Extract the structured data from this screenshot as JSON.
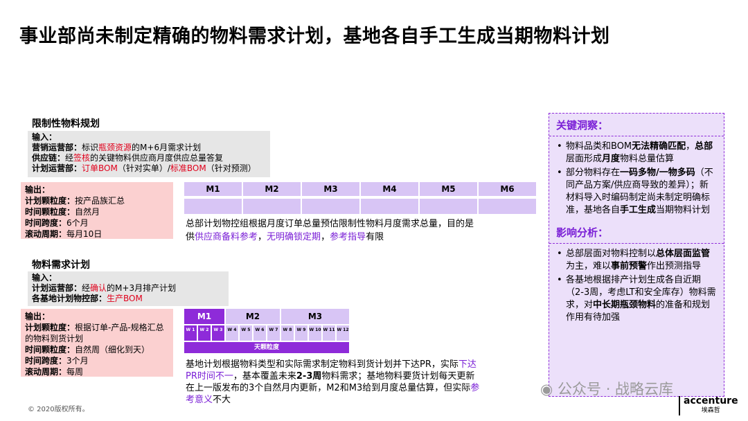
{
  "title": "事业部尚未制定精确的物料需求计划，基地各自手工生成当期物料计划",
  "section1": {
    "heading": "限制性物料规划",
    "input_label": "输入：",
    "inputs": [
      {
        "label": "营销运营部：",
        "pre": "标识",
        "hl": "瓶颈资源",
        "post": "的M+6月需求计划"
      },
      {
        "label": "供应链：",
        "pre": "经",
        "hl": "签核",
        "post": "的关键物料供应商月度供应总量答复"
      },
      {
        "label": "计划运营部：",
        "pre": "",
        "hl": "订单BOM",
        "mid": "（针对实单）/",
        "hl2": "标准BOM",
        "post": "（针对预测）"
      }
    ],
    "output_label": "输出：",
    "outputs": [
      {
        "label": "计划颗粒度：",
        "value": "按产品族汇总"
      },
      {
        "label": "时间颗粒度：",
        "value": "自然月"
      },
      {
        "label": "时间跨度：",
        "value": "6个月"
      },
      {
        "label": "滚动周期：",
        "value": "每月10日"
      }
    ],
    "months": [
      "M1",
      "M2",
      "M3",
      "M4",
      "M5",
      "M6"
    ],
    "desc_line1": "总部计划物控组根据月度订单总量预估限制性物料月度需求总量，目的是",
    "desc_pre": "供",
    "desc_hl1": "供应商备料参考",
    "desc_sep1": "，",
    "desc_hl2": "无明确锁定期",
    "desc_sep2": "，",
    "desc_hl3": "参考指导",
    "desc_post": "有限"
  },
  "section2": {
    "heading": "物料需求计划",
    "input_label": "输入：",
    "inputs": [
      {
        "label": "计划运营部：",
        "pre": "经",
        "hl": "确认",
        "post": "的M+3月排产计划"
      },
      {
        "label": "各基地计划物控部：",
        "pre": "",
        "hl": "生产BOM",
        "post": ""
      }
    ],
    "output_label": "输出：",
    "outputs": [
      {
        "label": "计划颗粒度：",
        "value": "根据订单-产品-规格汇总的物料到货计划"
      },
      {
        "label": "时间颗粒度：",
        "value": "自然周（细化到天）"
      },
      {
        "label": "时间跨度：",
        "value": "3个月"
      },
      {
        "label": "滚动周期：",
        "value": "每周"
      }
    ],
    "months": [
      "M1",
      "M2",
      "M3"
    ],
    "weeks": [
      "W 1",
      "W 2",
      "W 3",
      "W 4",
      "W 5",
      "W 6",
      "W 7",
      "W 8",
      "W 9",
      "W 10",
      "W 11",
      "W 12"
    ],
    "week_footer": "天颗粒度",
    "desc_line1_pre": "基地计划根据物料类型和实际需求制定物料到货计划并下达PR，实际",
    "desc_line1_hl": "下达",
    "desc_line2_hl": "PR时间不一",
    "desc_line2_pre": "，基本覆盖未来",
    "desc_line2_bold": "2-3周",
    "desc_line2_post": "物料需求；基地物料要货计划每天更新",
    "desc_line3_pre": "在上一版发布的3个自然月内更新，M2和M3给到月度总量估算，但实际",
    "desc_line3_hl": "参",
    "desc_line4_hl": "考意义",
    "desc_line4_post": "不大"
  },
  "panel": {
    "insight_title": "关键洞察：",
    "insight_1_pre": "物料品类和BOM",
    "insight_1_bold1": "无法精确匹配",
    "insight_1_mid": "，",
    "insight_1_bold2": "总部",
    "insight_1_mid2": "层面形成",
    "insight_1_bold3": "月度",
    "insight_1_post": "物料总量估算",
    "insight_2_pre": "部分物料存在",
    "insight_2_bold": "一码多物/一物多码",
    "insight_2_mid": "（不同产品方案/供应商导致的差异）；新材料导入时编码制定尚未制定明确标准，基地各自",
    "insight_2_bold2": "手工生成",
    "insight_2_post": "当期物料计划",
    "impact_title": "影响分析：",
    "impact_1_pre": "总部层面对物料控制以",
    "impact_1_bold1": "总体层面监管",
    "impact_1_mid": "为主，难以",
    "impact_1_bold2": "事前预警",
    "impact_1_post": "作出预测指导",
    "impact_2_pre": "各基地根据排产计划生成各自近期（2-3周，考虑LT和安全库存）物料需求，对",
    "impact_2_bold": "中长期瓶颈物料",
    "impact_2_post": "的准备和规划作用有待加强"
  },
  "footer": {
    "copyright": "© 2020版权所有。",
    "watermark": "公众号 · 战略云库",
    "brand": "accenture",
    "brand_cn": "埃森哲"
  }
}
